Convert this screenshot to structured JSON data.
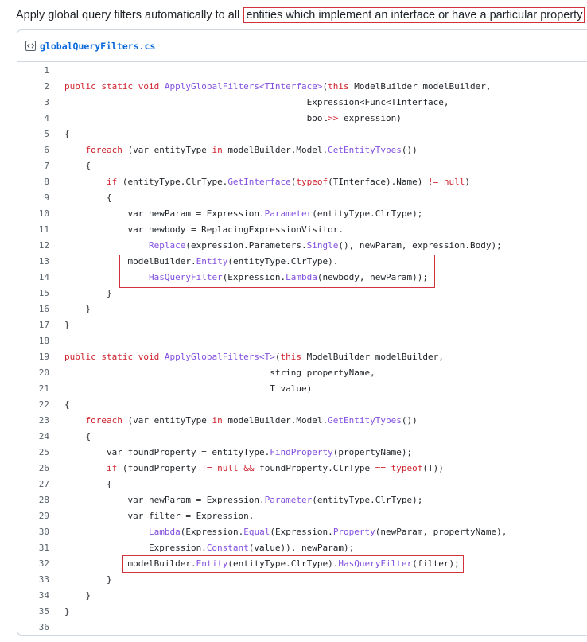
{
  "intro": {
    "prefix": "Apply global query filters automatically to all ",
    "highlighted": "entities which implement an interface or have a particular property"
  },
  "file": {
    "name": "globalQueryFilters.cs",
    "icon": "code-file-icon"
  },
  "colors": {
    "keyword": "#cf222e",
    "function": "#8250df",
    "text": "#1f2328",
    "line_number": "#57606a",
    "highlight_border": "#d0313b",
    "file_link": "#0969da"
  },
  "code_lines": [
    [],
    [
      [
        "kw",
        "public static void "
      ],
      [
        "fn",
        "ApplyGlobalFilters<TInterface>"
      ],
      [
        "t",
        "("
      ],
      [
        "kw",
        "this"
      ],
      [
        "t",
        " ModelBuilder modelBuilder,"
      ]
    ],
    [
      [
        "t",
        "                                              Expression<Func<TInterface,"
      ]
    ],
    [
      [
        "t",
        "                                              bool"
      ],
      [
        "kw",
        ">>"
      ],
      [
        "t",
        " expression)"
      ]
    ],
    [
      [
        "t",
        "{"
      ]
    ],
    [
      [
        "t",
        "    "
      ],
      [
        "kw",
        "foreach"
      ],
      [
        "t",
        " (var entityType "
      ],
      [
        "kw",
        "in"
      ],
      [
        "t",
        " modelBuilder.Model."
      ],
      [
        "fn",
        "GetEntityTypes"
      ],
      [
        "t",
        "())"
      ]
    ],
    [
      [
        "t",
        "    {"
      ]
    ],
    [
      [
        "t",
        "        "
      ],
      [
        "kw",
        "if"
      ],
      [
        "t",
        " (entityType.ClrType."
      ],
      [
        "fn",
        "GetInterface"
      ],
      [
        "t",
        "("
      ],
      [
        "kw",
        "typeof"
      ],
      [
        "t",
        "(TInterface).Name) "
      ],
      [
        "kw",
        "!="
      ],
      [
        "t",
        " "
      ],
      [
        "kw",
        "null"
      ],
      [
        "t",
        ")"
      ]
    ],
    [
      [
        "t",
        "        {"
      ]
    ],
    [
      [
        "t",
        "            var newParam = Expression."
      ],
      [
        "fn",
        "Parameter"
      ],
      [
        "t",
        "(entityType.ClrType);"
      ]
    ],
    [
      [
        "t",
        "            var newbody = ReplacingExpressionVisitor."
      ]
    ],
    [
      [
        "t",
        "                "
      ],
      [
        "fn",
        "Replace"
      ],
      [
        "t",
        "(expression.Parameters."
      ],
      [
        "fn",
        "Single"
      ],
      [
        "t",
        "(), newParam, expression.Body);"
      ]
    ],
    [
      [
        "t",
        "            modelBuilder."
      ],
      [
        "fn",
        "Entity"
      ],
      [
        "t",
        "(entityType.ClrType)."
      ]
    ],
    [
      [
        "t",
        "                "
      ],
      [
        "fn",
        "HasQueryFilter"
      ],
      [
        "t",
        "(Expression."
      ],
      [
        "fn",
        "Lambda"
      ],
      [
        "t",
        "(newbody, newParam));"
      ]
    ],
    [
      [
        "t",
        "        }"
      ]
    ],
    [
      [
        "t",
        "    }"
      ]
    ],
    [
      [
        "t",
        "}"
      ]
    ],
    [],
    [
      [
        "kw",
        "public static void "
      ],
      [
        "fn",
        "ApplyGlobalFilters<T>"
      ],
      [
        "t",
        "("
      ],
      [
        "kw",
        "this"
      ],
      [
        "t",
        " ModelBuilder modelBuilder,"
      ]
    ],
    [
      [
        "t",
        "                                       string propertyName,"
      ]
    ],
    [
      [
        "t",
        "                                       T value)"
      ]
    ],
    [
      [
        "t",
        "{"
      ]
    ],
    [
      [
        "t",
        "    "
      ],
      [
        "kw",
        "foreach"
      ],
      [
        "t",
        " (var entityType "
      ],
      [
        "kw",
        "in"
      ],
      [
        "t",
        " modelBuilder.Model."
      ],
      [
        "fn",
        "GetEntityTypes"
      ],
      [
        "t",
        "())"
      ]
    ],
    [
      [
        "t",
        "    {"
      ]
    ],
    [
      [
        "t",
        "        var foundProperty = entityType."
      ],
      [
        "fn",
        "FindProperty"
      ],
      [
        "t",
        "(propertyName);"
      ]
    ],
    [
      [
        "t",
        "        "
      ],
      [
        "kw",
        "if"
      ],
      [
        "t",
        " (foundProperty "
      ],
      [
        "kw",
        "!="
      ],
      [
        "t",
        " "
      ],
      [
        "kw",
        "null"
      ],
      [
        "t",
        " "
      ],
      [
        "kw",
        "&&"
      ],
      [
        "t",
        " foundProperty.ClrType "
      ],
      [
        "kw",
        "=="
      ],
      [
        "t",
        " "
      ],
      [
        "kw",
        "typeof"
      ],
      [
        "t",
        "(T))"
      ]
    ],
    [
      [
        "t",
        "        {"
      ]
    ],
    [
      [
        "t",
        "            var newParam = Expression."
      ],
      [
        "fn",
        "Parameter"
      ],
      [
        "t",
        "(entityType.ClrType);"
      ]
    ],
    [
      [
        "t",
        "            var filter = Expression."
      ]
    ],
    [
      [
        "t",
        "                "
      ],
      [
        "fn",
        "Lambda"
      ],
      [
        "t",
        "(Expression."
      ],
      [
        "fn",
        "Equal"
      ],
      [
        "t",
        "(Expression."
      ],
      [
        "fn",
        "Property"
      ],
      [
        "t",
        "(newParam, propertyName),"
      ]
    ],
    [
      [
        "t",
        "                Expression."
      ],
      [
        "fn",
        "Constant"
      ],
      [
        "t",
        "(value)), newParam);"
      ]
    ],
    [
      [
        "t",
        "            modelBuilder."
      ],
      [
        "fn",
        "Entity"
      ],
      [
        "t",
        "(entityType.ClrType)."
      ],
      [
        "fn",
        "HasQueryFilter"
      ],
      [
        "t",
        "(filter);"
      ]
    ],
    [
      [
        "t",
        "        }"
      ]
    ],
    [
      [
        "t",
        "    }"
      ]
    ],
    [
      [
        "t",
        "}"
      ]
    ],
    []
  ]
}
